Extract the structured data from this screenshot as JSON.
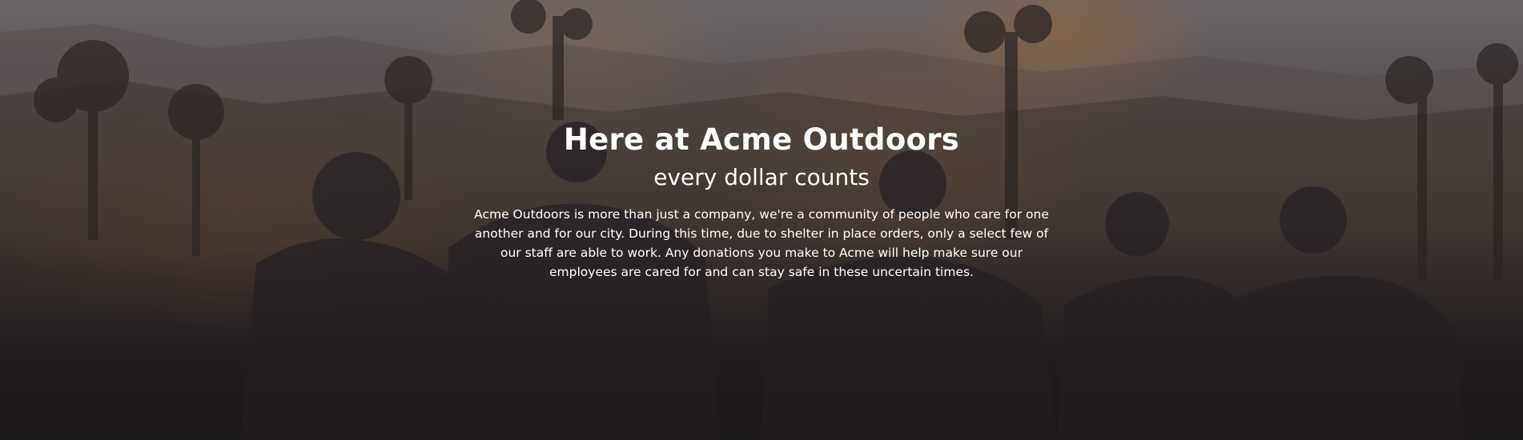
{
  "hero": {
    "title": "Here at Acme Outdoors",
    "subtitle": "every dollar counts",
    "body": "Acme Outdoors is more than just a company, we're a community of people who care for one another and for our city. During this time, due to shelter in place orders, only a select few of our staff are able to work. Any donations you make to Acme will help make sure our employees are cared for and can stay safe in these uncertain times."
  },
  "colors": {
    "text": "#ffffff",
    "sky": "#8a8588",
    "ground": "#1f1c1e",
    "sun_glow": "#d68c3c"
  }
}
